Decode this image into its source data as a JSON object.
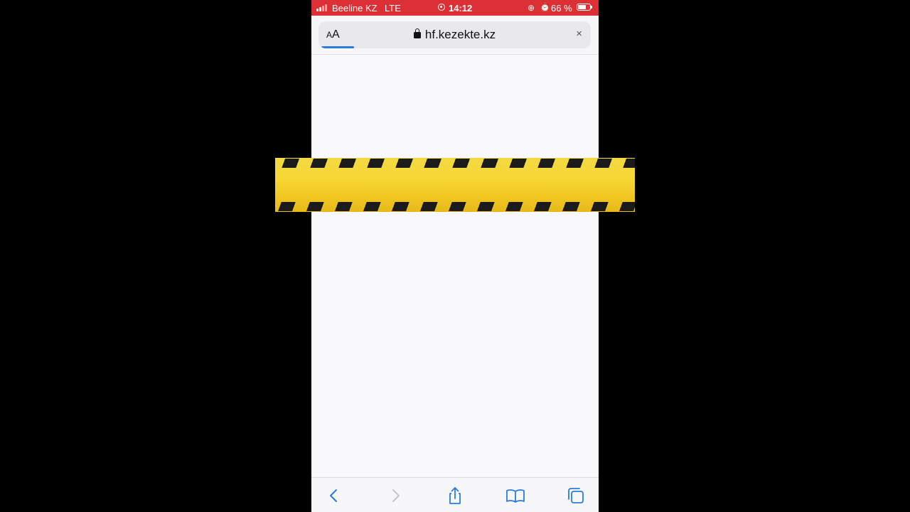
{
  "status_bar": {
    "carrier": "Beeline KZ",
    "network": "LTE",
    "time": "14:12",
    "battery_percent": "66 %",
    "background_color": "#dc2f36"
  },
  "browser": {
    "text_size_label_small": "A",
    "text_size_label_large": "A",
    "url": "hf.kezekte.kz",
    "close_symbol": "×",
    "load_progress": 0.12
  },
  "toolbar": {
    "icons": [
      "back-icon",
      "forward-icon",
      "share-icon",
      "bookmarks-icon",
      "tabs-icon"
    ],
    "accent_color": "#2b7bdc"
  },
  "overlay": {
    "caution_tape_color": "#f3d944"
  }
}
